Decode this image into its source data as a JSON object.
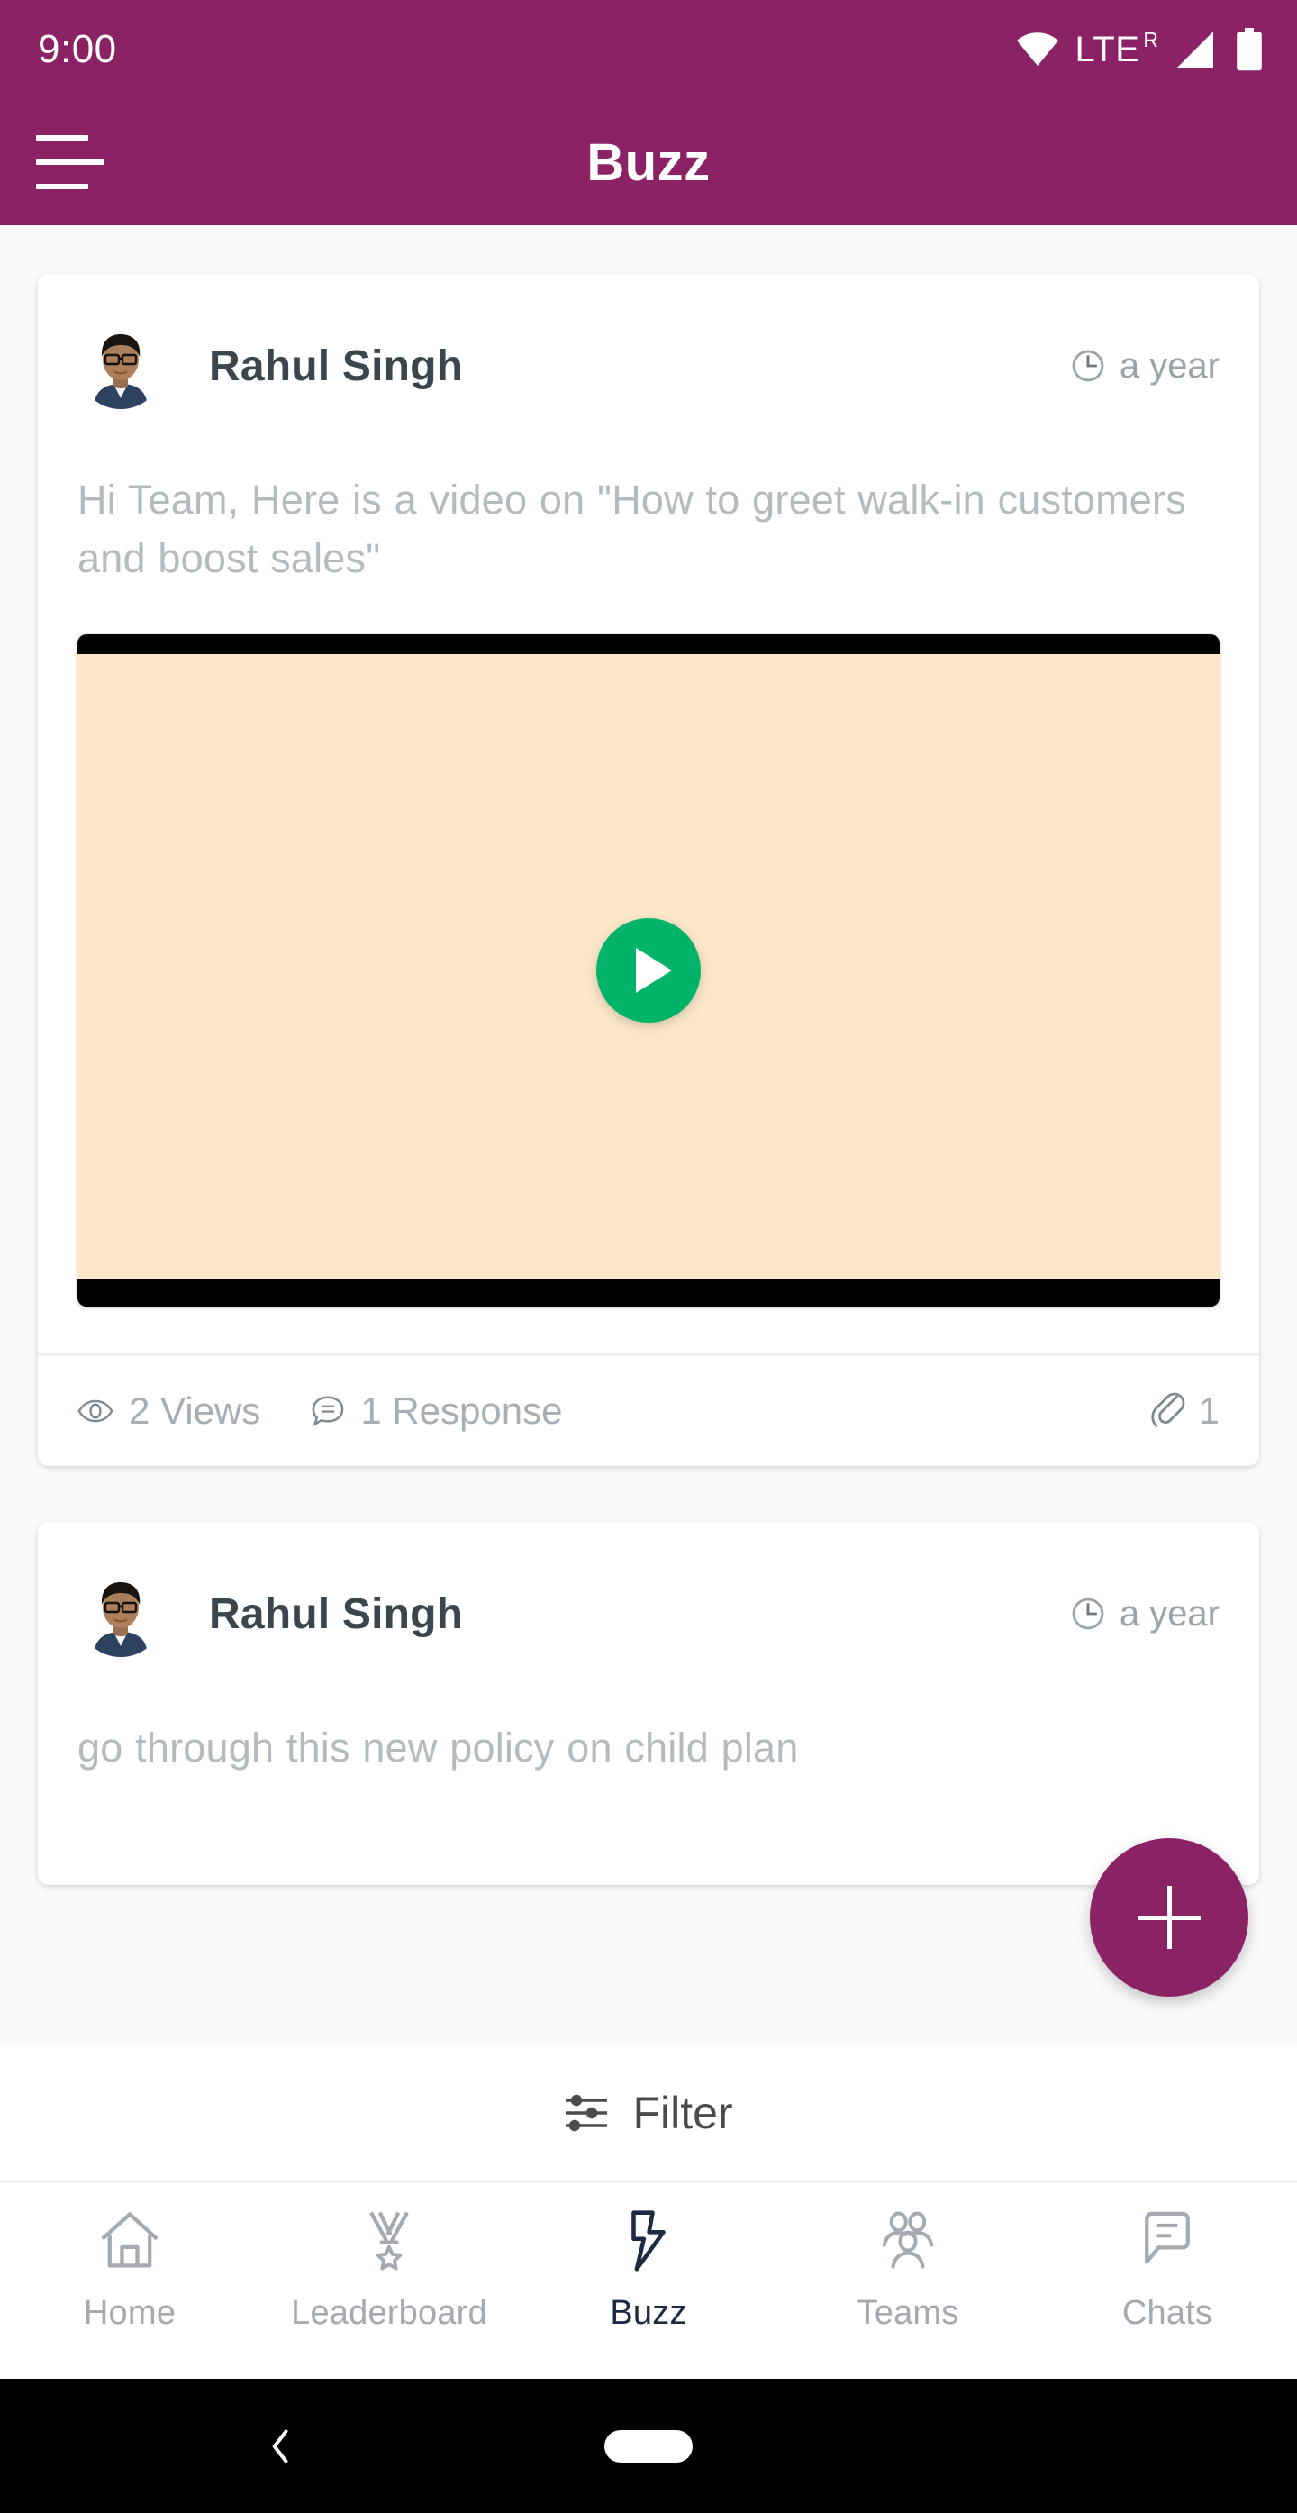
{
  "status_bar": {
    "time": "9:00",
    "network_label": "LTE",
    "roaming_indicator": "R",
    "icons": [
      "wifi-icon",
      "signal-icon",
      "battery-icon"
    ]
  },
  "app_bar": {
    "title": "Buzz",
    "menu_icon": "hamburger-menu-icon"
  },
  "feed": {
    "posts": [
      {
        "author": "Rahul Singh",
        "time": "a year",
        "time_icon": "clock-icon",
        "body": "Hi Team, Here is a video on \"How to greet walk-in customers and boost sales\"",
        "has_video": true,
        "video": {
          "play_icon": "play-icon",
          "play_button_color": "#00b368",
          "thumbnail_color": "#fce8c8"
        },
        "stats": {
          "views_icon": "eye-icon",
          "views": "2 Views",
          "responses_icon": "comment-icon",
          "responses": "1 Response",
          "attachment_icon": "paperclip-icon",
          "attachment_count": "1"
        }
      },
      {
        "author": "Rahul Singh",
        "time": "a year",
        "time_icon": "clock-icon",
        "body": "go through this  new policy on child plan",
        "has_video": false
      }
    ]
  },
  "fab": {
    "label": "+",
    "icon": "plus-icon",
    "color": "#8b2265"
  },
  "filter_bar": {
    "label": "Filter",
    "icon": "filter-sliders-icon"
  },
  "bottom_nav": {
    "items": [
      {
        "label": "Home",
        "icon": "home-icon",
        "active": false
      },
      {
        "label": "Leaderboard",
        "icon": "medal-icon",
        "active": false
      },
      {
        "label": "Buzz",
        "icon": "lightning-bolt-icon",
        "active": true
      },
      {
        "label": "Teams",
        "icon": "people-group-icon",
        "active": false
      },
      {
        "label": "Chats",
        "icon": "chat-bubble-icon",
        "active": false
      }
    ]
  },
  "system_nav": {
    "back_icon": "back-chevron-icon",
    "home_icon": "home-pill-icon"
  },
  "theme": {
    "brand_purple": "#8b2265",
    "accent_green": "#00b368",
    "text_dark": "#3a454c",
    "text_muted": "#b4bbbf",
    "nav_active": "#1c2b42",
    "page_bg": "#fafafa"
  }
}
